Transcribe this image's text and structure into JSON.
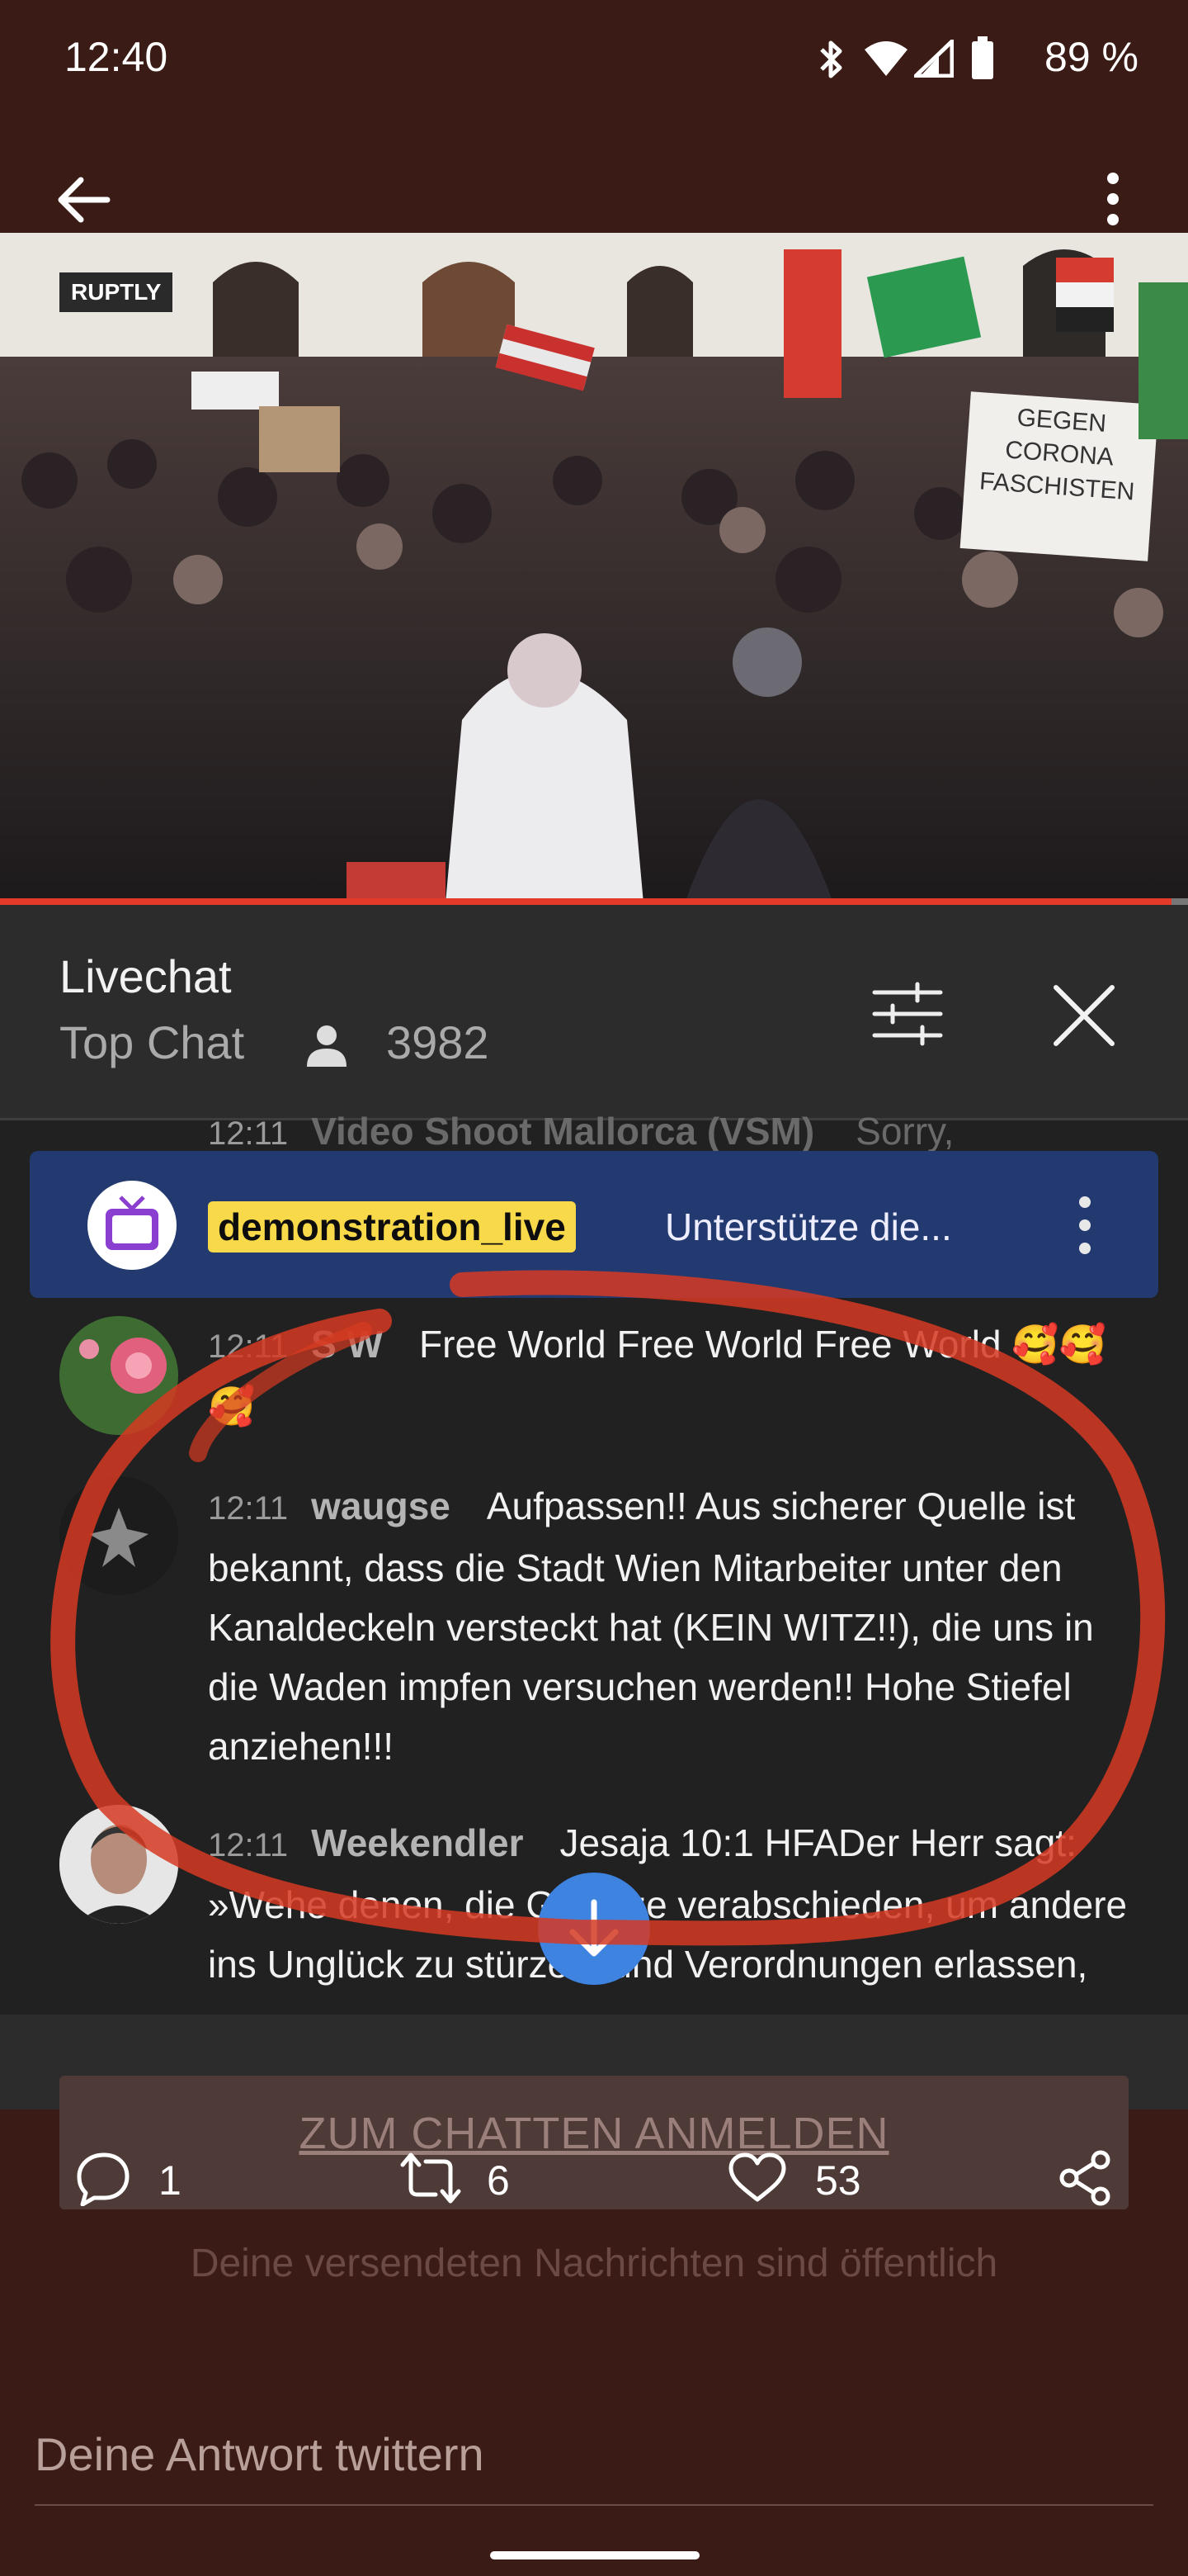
{
  "status_bar": {
    "time": "12:40",
    "battery": "89 %",
    "icons": [
      "bluetooth-icon",
      "wifi-icon",
      "signal-icon",
      "battery-icon"
    ]
  },
  "app_bar": {
    "back_icon": "arrow-left-icon",
    "more_icon": "more-vertical-icon"
  },
  "video": {
    "watermark": "RUPTLY",
    "sign_text": "GEGEN\nCORONA\nFASCHISTEN"
  },
  "chat": {
    "title": "Livechat",
    "mode": "Top Chat",
    "viewer_count": "3982",
    "partial_top": {
      "timestamp": "12:11",
      "author": "Video Shoot Mallorca (VSM)",
      "text": "Sorry,"
    },
    "pinned": {
      "channel": "demonstration_live",
      "text": "Unterstütze die..."
    },
    "messages": [
      {
        "timestamp": "12:11",
        "author": "S W",
        "text": "Free World Free World Free World 🥰🥰🥰"
      },
      {
        "timestamp": "12:11",
        "author": "waugse",
        "text": "Aufpassen!! Aus sicherer Quelle ist bekannt, dass die Stadt Wien Mitarbeiter unter den Kanaldeckeln versteckt hat (KEIN WITZ!!), die uns in die Waden impfen versuchen werden!! Hohe Stiefel anziehen!!!"
      },
      {
        "timestamp": "12:11",
        "author": "Weekendler",
        "text": "Jesaja 10:1 HFADer Herr sagt: »Wehe denen, die Gesetze verabschieden, um andere ins Unglück zu stürzen, und Verordnungen erlassen, um"
      }
    ],
    "login_button": "ZUM CHATTEN ANMELDEN",
    "public_note": "Deine versendeten Nachrichten sind öffentlich"
  },
  "tweet_actions": {
    "replies": "1",
    "retweets": "6",
    "likes": "53"
  },
  "reply": {
    "placeholder": "Deine Antwort twittern"
  },
  "colors": {
    "background": "#3a1b16",
    "chat_bg": "#212121",
    "pinned_bg": "#233a70",
    "pinned_tag": "#f8d94a",
    "annotation_red": "#d63a22"
  }
}
